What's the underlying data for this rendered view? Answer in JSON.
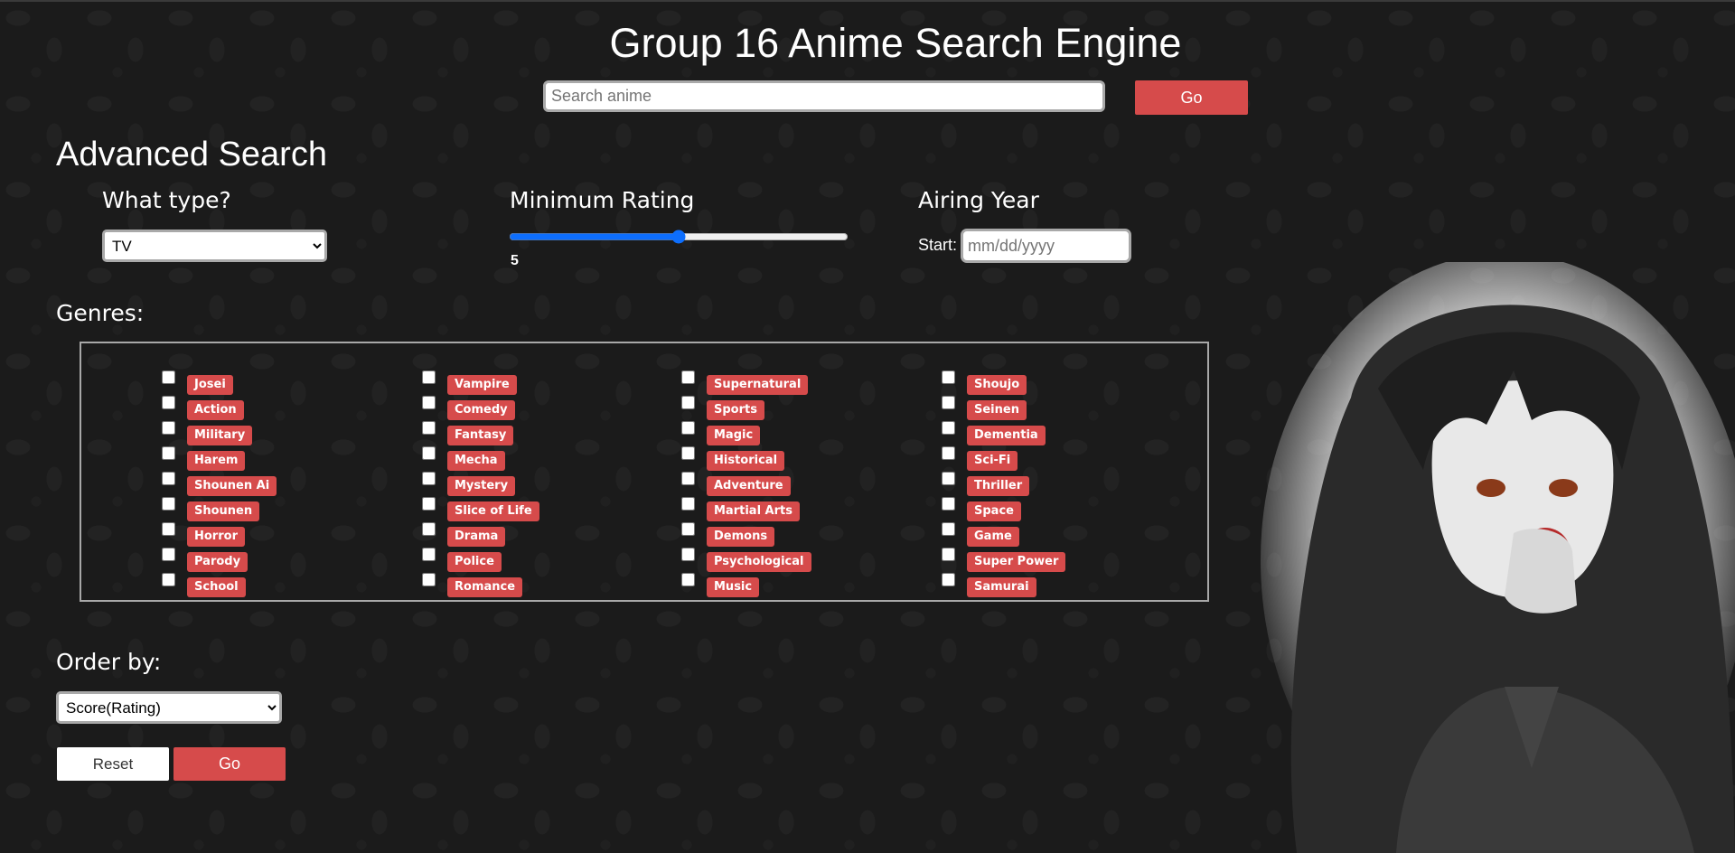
{
  "header": {
    "title": "Group 16 Anime Search Engine",
    "search_placeholder": "Search anime",
    "go_label": "Go"
  },
  "advanced": {
    "title": "Advanced Search",
    "type": {
      "label": "What type?",
      "selected": "TV"
    },
    "rating": {
      "label": "Minimum Rating",
      "value": "5",
      "min": 0,
      "max": 10
    },
    "airing": {
      "label": "Airing Year",
      "start_label": "Start:",
      "date_placeholder": "mm/dd/yyyy"
    },
    "genres_label": "Genres:",
    "genres": [
      [
        "Josei",
        "Action",
        "Military",
        "Harem",
        "Shounen Ai",
        "Shounen",
        "Horror",
        "Parody",
        "School"
      ],
      [
        "Vampire",
        "Comedy",
        "Fantasy",
        "Mecha",
        "Mystery",
        "Slice of Life",
        "Drama",
        "Police",
        "Romance"
      ],
      [
        "Supernatural",
        "Sports",
        "Magic",
        "Historical",
        "Adventure",
        "Martial Arts",
        "Demons",
        "Psychological",
        "Music"
      ],
      [
        "Shoujo",
        "Seinen",
        "Dementia",
        "Sci-Fi",
        "Thriller",
        "Space",
        "Game",
        "Super Power",
        "Samurai"
      ]
    ],
    "order": {
      "label": "Order by:",
      "selected": "Score(Rating)"
    },
    "reset_label": "Reset",
    "go_label": "Go"
  },
  "colors": {
    "accent": "#d64b4b",
    "background": "#1b1b1b",
    "slider": "#0d6efd"
  }
}
